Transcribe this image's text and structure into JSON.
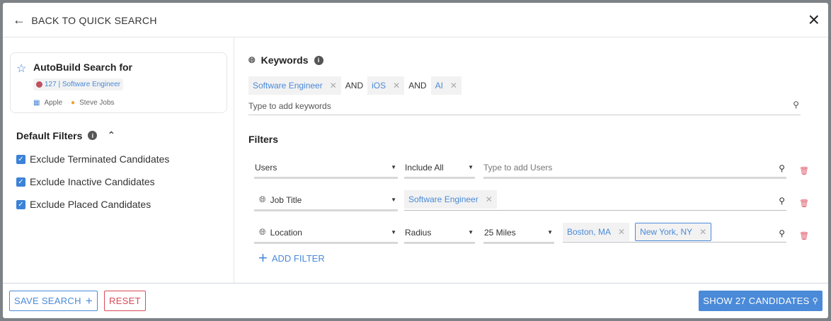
{
  "header": {
    "back_label": "BACK TO QUICK SEARCH",
    "close": "×"
  },
  "autobuild": {
    "title": "AutoBuild Search for",
    "job": "127 | Software Engineer",
    "company": "Apple",
    "contact": "Steve Jobs"
  },
  "default_filters": {
    "title": "Default Filters",
    "items": [
      {
        "label": "Exclude Terminated Candidates",
        "checked": true
      },
      {
        "label": "Exclude Inactive Candidates",
        "checked": true
      },
      {
        "label": "Exclude Placed Candidates",
        "checked": true
      }
    ]
  },
  "keywords": {
    "title": "Keywords",
    "tags": [
      "Software Engineer",
      "iOS",
      "AI"
    ],
    "operator": "AND",
    "placeholder": "Type to add keywords"
  },
  "filters": {
    "title": "Filters",
    "users": {
      "field": "Users",
      "mode": "Include All",
      "placeholder": "Type to add Users"
    },
    "job_title": {
      "field": "Job Title",
      "tags": [
        "Software Engineer"
      ]
    },
    "location": {
      "field": "Location",
      "mode": "Radius",
      "distance": "25 Miles",
      "tags": [
        "Boston, MA",
        "New York, NY"
      ]
    },
    "add_label": "ADD FILTER"
  },
  "footer": {
    "save_label": "SAVE SEARCH",
    "reset_label": "RESET",
    "show_label": "SHOW 27 CANDIDATES"
  },
  "colors": {
    "accent": "#4a8ad8",
    "danger": "#e05a6a",
    "primary_btn": "#4a8ad8"
  }
}
